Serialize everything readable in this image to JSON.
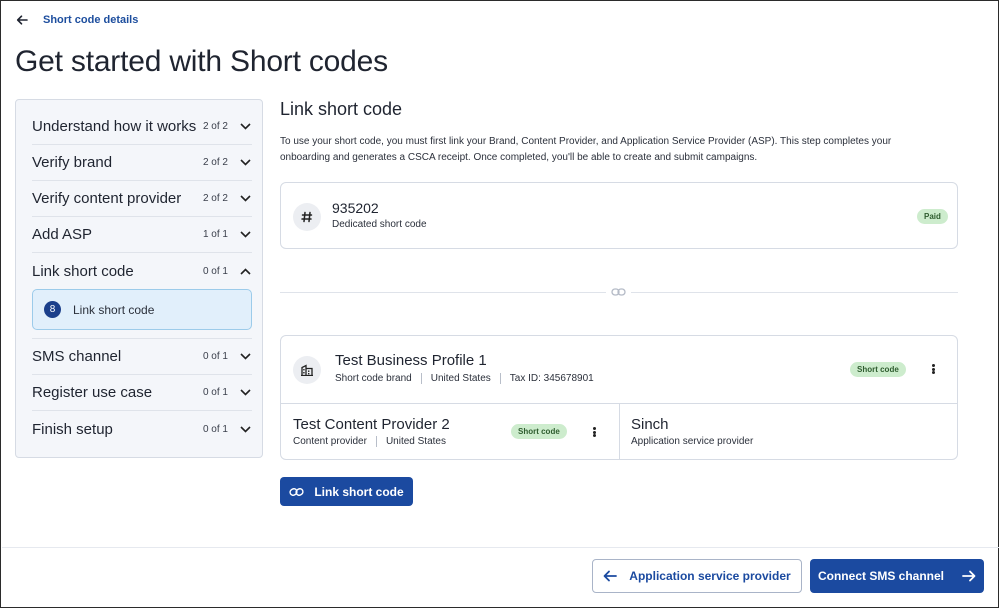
{
  "topbar": {
    "back_label": "Short code details"
  },
  "page": {
    "title": "Get started with Short codes"
  },
  "sidebar": {
    "steps": [
      {
        "title": "Understand how it works",
        "count": "2 of 2",
        "expanded": false
      },
      {
        "title": "Verify brand",
        "count": "2 of 2",
        "expanded": false
      },
      {
        "title": "Verify content provider",
        "count": "2 of 2",
        "expanded": false
      },
      {
        "title": "Add ASP",
        "count": "1 of 1",
        "expanded": false
      },
      {
        "title": "Link short code",
        "count": "0 of 1",
        "expanded": true
      },
      {
        "title": "SMS channel",
        "count": "0 of 1",
        "expanded": false
      },
      {
        "title": "Register use case",
        "count": "0 of 1",
        "expanded": false
      },
      {
        "title": "Finish setup",
        "count": "0 of 1",
        "expanded": false
      }
    ],
    "sub_step": {
      "number": "8",
      "label": "Link short code"
    }
  },
  "main": {
    "title": "Link short code",
    "description": "To use your short code, you must first link your Brand, Content Provider, and Application Service Provider (ASP). This step completes your onboarding and generates a CSCA receipt. Once completed, you'll be able to create and submit campaigns.",
    "short_code_card": {
      "code": "935202",
      "subtitle": "Dedicated short code",
      "badge": "Paid"
    },
    "brand_card": {
      "name": "Test Business Profile 1",
      "meta": [
        "Short code brand",
        "United States",
        "Tax ID: 345678901"
      ],
      "badge": "Short code"
    },
    "content_provider": {
      "name": "Test Content Provider 2",
      "meta": [
        "Content provider",
        "United States"
      ],
      "badge": "Short code"
    },
    "asp": {
      "name": "Sinch",
      "subtitle": "Application service provider"
    },
    "link_button": "Link short code"
  },
  "footer": {
    "back_button": "Application service provider",
    "next_button": "Connect SMS channel"
  },
  "colors": {
    "primary": "#1b4aa0",
    "badge_bg": "#cdeccd",
    "badge_text": "#2f5d2f",
    "selected_bg": "#e1effb"
  },
  "icons": {
    "back": "arrow-left-icon",
    "hash": "hash-icon",
    "link": "link-icon",
    "building": "building-icon",
    "chevron": "chevron-down-icon",
    "kebab": "more-vertical-icon"
  }
}
